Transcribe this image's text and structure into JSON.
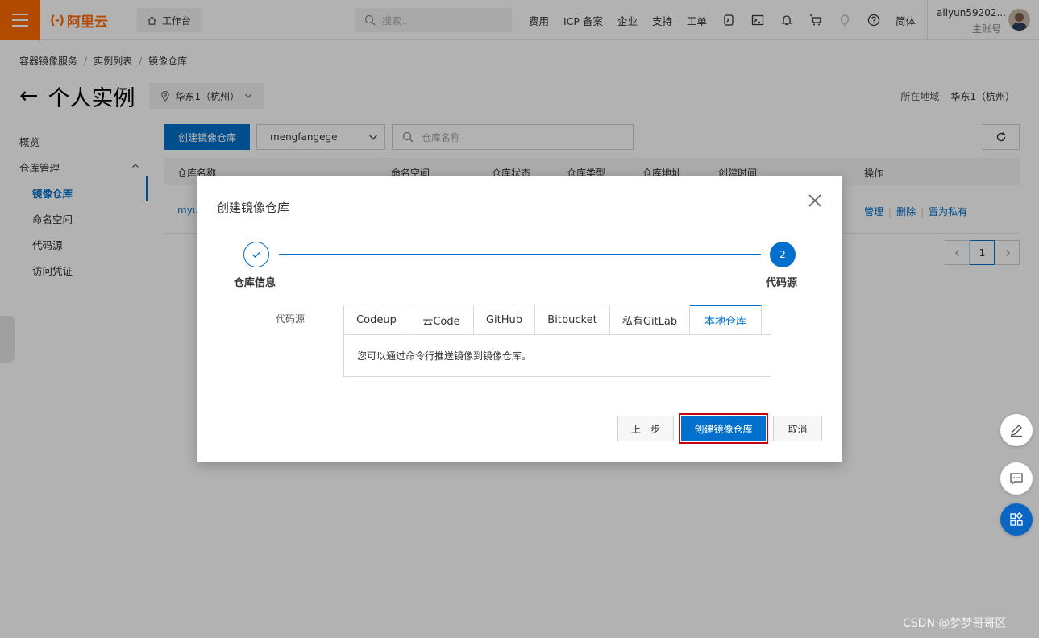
{
  "topbar": {
    "logo_text": "阿里云",
    "logo_mark": "(-)",
    "workbench": "工作台",
    "search_placeholder": "搜索...",
    "nav": [
      "费用",
      "ICP 备案",
      "企业",
      "支持",
      "工单"
    ],
    "lang": "简体",
    "user_name": "aliyun59202...",
    "user_role": "主账号"
  },
  "breadcrumb": [
    "容器镜像服务",
    "实例列表",
    "镜像仓库"
  ],
  "page": {
    "title": "个人实例",
    "region": "华东1（杭州）",
    "region_label": "所在地域",
    "region_value": "华东1（杭州）"
  },
  "sidebar": {
    "overview": "概览",
    "repo_mgmt": "仓库管理",
    "items": [
      "镜像仓库",
      "命名空间",
      "代码源",
      "访问凭证"
    ]
  },
  "toolbar": {
    "create_label": "创建镜像仓库",
    "namespace": "mengfangege",
    "search_placeholder": "仓库名称"
  },
  "table": {
    "headers": [
      "仓库名称",
      "命名空间",
      "仓库状态",
      "仓库类型",
      "仓库地址",
      "创建时间",
      "操作"
    ],
    "row_name": "myul",
    "ops": [
      "管理",
      "删除",
      "置为私有"
    ]
  },
  "pager": {
    "current": "1"
  },
  "modal": {
    "title": "创建镜像仓库",
    "step1": "仓库信息",
    "step2_num": "2",
    "step2": "代码源",
    "field_label": "代码源",
    "tabs": [
      "Codeup",
      "云Code",
      "GitHub",
      "Bitbucket",
      "私有GitLab",
      "本地仓库"
    ],
    "active_tab": "本地仓库",
    "panel_text": "您可以通过命令行推送镜像到镜像仓库。",
    "prev_label": "上一步",
    "create_label": "创建镜像仓库",
    "cancel_label": "取消"
  },
  "watermark": "CSDN @梦梦哥哥区",
  "colors": {
    "brand": "#ff6a00",
    "primary": "#0070cc",
    "highlight": "#c7000b"
  }
}
